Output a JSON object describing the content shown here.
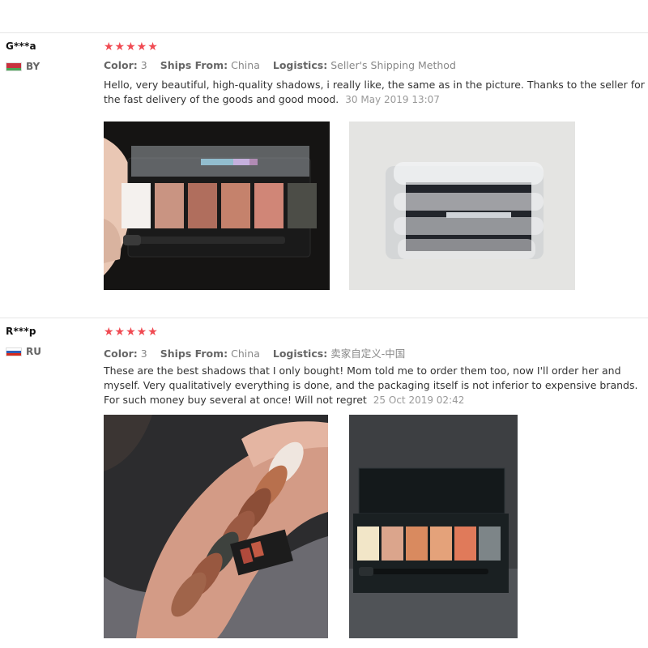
{
  "reviews": [
    {
      "user": "G***a",
      "country": "BY",
      "stars": "★★★★★",
      "color_label": "Color:",
      "color_value": "3",
      "ships_label": "Ships From:",
      "ships_value": "China",
      "logistics_label": "Logistics:",
      "logistics_value": "Seller's Shipping Method",
      "text": "Hello, very beautiful, high-quality shadows, i really like, the same as in the picture. Thanks to the seller for the fast delivery of the goods and good mood.",
      "date": "30 May 2019 13:07"
    },
    {
      "user": "R***p",
      "country": "RU",
      "stars": "★★★★★",
      "color_label": "Color:",
      "color_value": "3",
      "ships_label": "Ships From:",
      "ships_value": "China",
      "logistics_label": "Logistics:",
      "logistics_value": "卖家自定义-中国",
      "text": "These are the best shadows that I only bought! Mom told me to order them too, now I'll order her and myself. Very qualitatively everything is done, and the packaging itself is not inferior to expensive brands. For such money buy several at once! Will not regret",
      "date": "25 Oct 2019 02:42"
    }
  ],
  "colors": {
    "star": "#f04a52",
    "separator": "#e6e6e6"
  }
}
